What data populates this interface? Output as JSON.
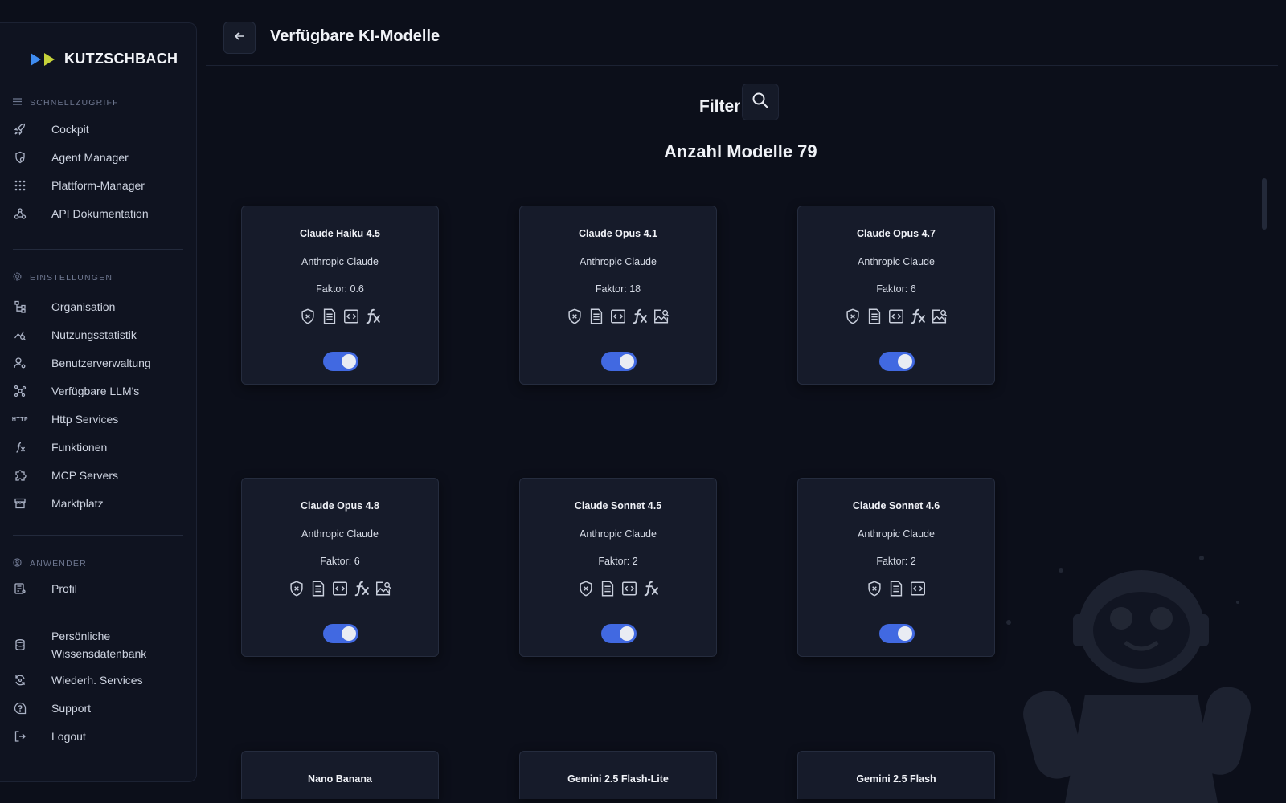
{
  "sidebar": {
    "brand": "KUTZSCHBACH",
    "sections": [
      {
        "title": "SCHNELLZUGRIFF",
        "items": [
          "Cockpit",
          "Agent Manager",
          "Plattform-Manager",
          "API Dokumentation"
        ]
      },
      {
        "title": "EINSTELLUNGEN",
        "items": [
          "Organisation",
          "Nutzungsstatistik",
          "Benutzerverwaltung",
          "Verfügbare LLM's",
          "Http Services",
          "Funktionen",
          "MCP Servers",
          "Marktplatz"
        ]
      },
      {
        "title": "ANWENDER",
        "items": [
          "Profil",
          "Persönliche Wissensdatenbank",
          "Wiederh. Services",
          "Support",
          "Logout"
        ]
      }
    ],
    "http_icon_text": "HTTP"
  },
  "header": {
    "title": "Verfügbare KI-Modelle"
  },
  "main": {
    "filter_label": "Filter",
    "count_label": "Anzahl Modelle",
    "count_value": "79",
    "models": [
      {
        "name": "Claude Haiku 4.5",
        "vendor": "Anthropic Claude",
        "factor": "Faktor: 0.6",
        "capabilities": [
          "shield-x-icon",
          "document-icon",
          "code-icon",
          "function-icon"
        ],
        "enabled": true
      },
      {
        "name": "Claude Opus 4.1",
        "vendor": "Anthropic Claude",
        "factor": "Faktor: 18",
        "capabilities": [
          "shield-x-icon",
          "document-icon",
          "code-icon",
          "function-icon",
          "image-search-icon"
        ],
        "enabled": true
      },
      {
        "name": "Claude Opus 4.7",
        "vendor": "Anthropic Claude",
        "factor": "Faktor: 6",
        "capabilities": [
          "shield-x-icon",
          "document-icon",
          "code-icon",
          "function-icon",
          "image-search-icon"
        ],
        "enabled": true
      },
      {
        "name": "Claude Opus 4.8",
        "vendor": "Anthropic Claude",
        "factor": "Faktor: 6",
        "capabilities": [
          "shield-x-icon",
          "document-icon",
          "code-icon",
          "function-icon",
          "image-search-icon"
        ],
        "enabled": true
      },
      {
        "name": "Claude Sonnet 4.5",
        "vendor": "Anthropic Claude",
        "factor": "Faktor: 2",
        "capabilities": [
          "shield-x-icon",
          "document-icon",
          "code-icon",
          "function-icon"
        ],
        "enabled": true
      },
      {
        "name": "Claude Sonnet 4.6",
        "vendor": "Anthropic Claude",
        "factor": "Faktor: 2",
        "capabilities": [
          "shield-x-icon",
          "document-icon",
          "code-icon"
        ],
        "enabled": true
      },
      {
        "name": "Nano Banana"
      },
      {
        "name": "Gemini 2.5 Flash-Lite"
      },
      {
        "name": "Gemini 2.5 Flash"
      }
    ]
  },
  "colors": {
    "background": "#0c0f1a",
    "card": "#161b2a",
    "toggle_on": "#4169e1",
    "logo_blue": "#3f8cf0",
    "logo_yellow": "#c6d23a"
  }
}
